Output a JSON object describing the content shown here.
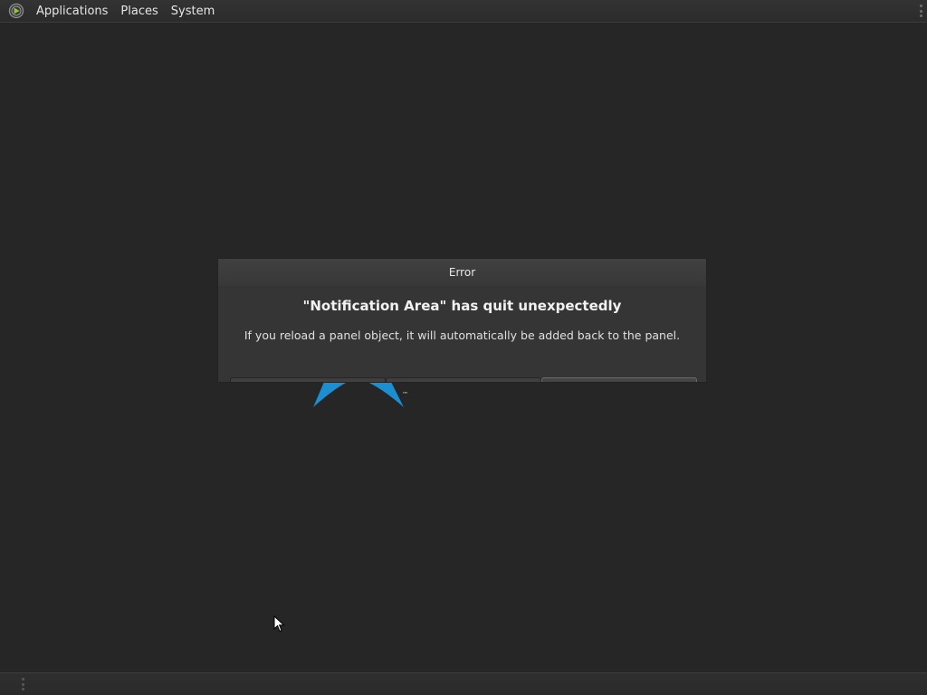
{
  "top_panel": {
    "logo_icon": "distro-logo-icon",
    "menus": [
      {
        "label": "Applications"
      },
      {
        "label": "Places"
      },
      {
        "label": "System"
      }
    ]
  },
  "desktop": {
    "logo_trademark": "™",
    "logo_color": "#1a8fd1"
  },
  "dialog": {
    "title": "Error",
    "heading": "\"Notification Area\" has quit unexpectedly",
    "message": "If you reload a panel object, it will automatically be added back to the panel."
  },
  "colors": {
    "background": "#262626",
    "panel": "#2e2e2e",
    "dialog": "#353535"
  }
}
